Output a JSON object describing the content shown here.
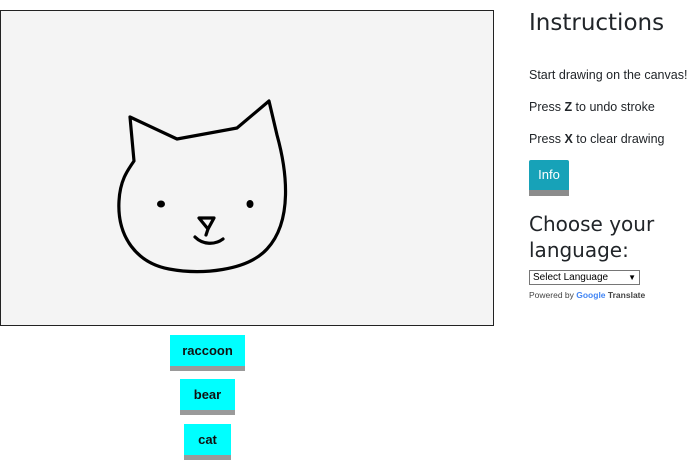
{
  "canvas": {
    "background": "#f4f4f4"
  },
  "guesses": [
    {
      "label": "raccoon"
    },
    {
      "label": "bear"
    },
    {
      "label": "cat"
    }
  ],
  "sidebar": {
    "title": "Instructions",
    "line1": "Start drawing on the canvas!",
    "line2_prefix": "Press ",
    "line2_key": "Z",
    "line2_suffix": " to undo stroke",
    "line3_prefix": "Press ",
    "line3_key": "X",
    "line3_suffix": " to clear drawing",
    "info_button": "Info",
    "language_title": "Choose your language:",
    "language_select": "Select Language",
    "powered_by": "Powered by ",
    "google": "Google",
    "translate": "Translate"
  },
  "colors": {
    "guess_button": "#00ffff",
    "info_button": "#17a2b8",
    "button_shadow": "#9a9a9a"
  }
}
